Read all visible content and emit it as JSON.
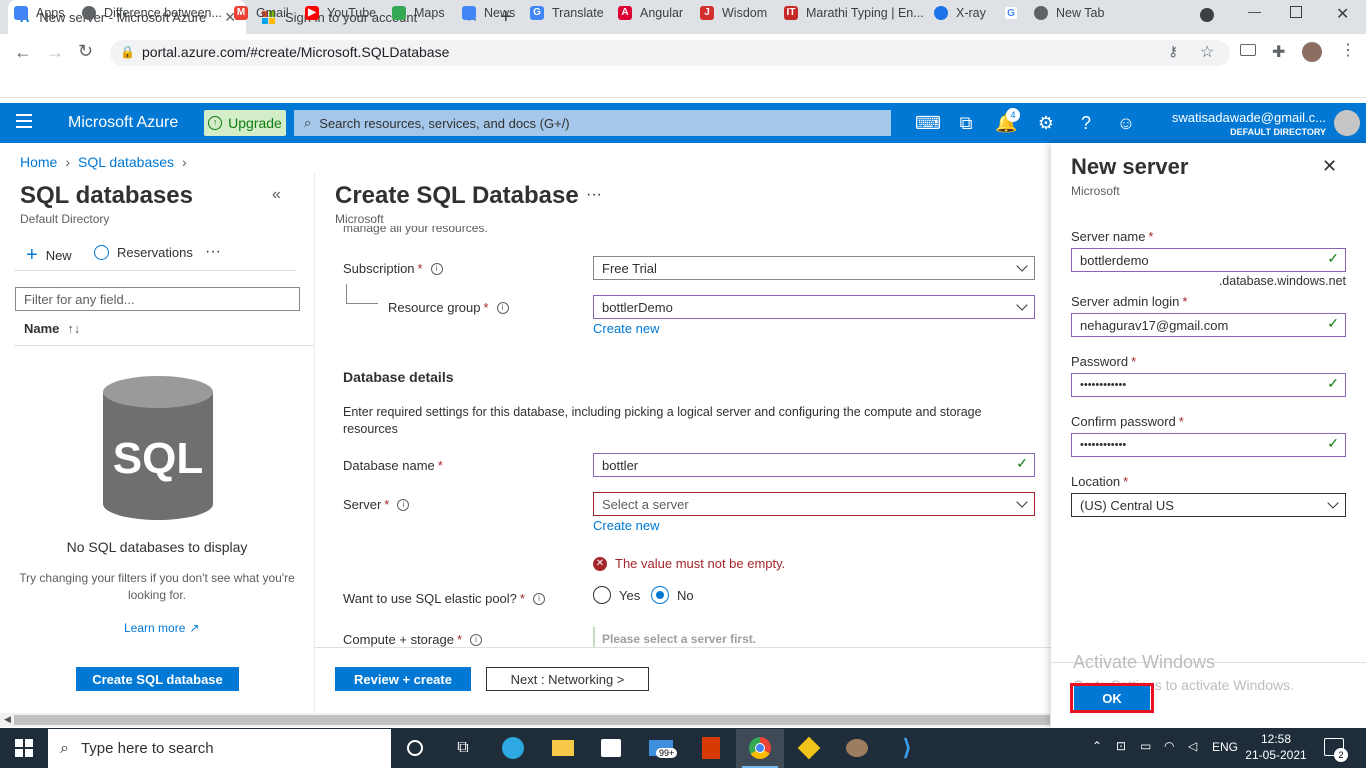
{
  "browser": {
    "tabs": [
      {
        "title": "New server - Microsoft Azure"
      },
      {
        "title": "Sign in to your account"
      }
    ],
    "url": "portal.azure.com/#create/Microsoft.SQLDatabase",
    "bookmarks": [
      "Apps",
      "Difference between...",
      "Gmail",
      "YouTube",
      "Maps",
      "News",
      "Translate",
      "Angular",
      "Wisdom",
      "Marathi Typing | En...",
      "X-ray",
      "New Tab"
    ]
  },
  "azure": {
    "brand": "Microsoft Azure",
    "upgrade": "Upgrade",
    "search_placeholder": "Search resources, services, and docs (G+/)",
    "notif_count": "4",
    "user_email": "swatisadawade@gmail.c...",
    "user_dir": "DEFAULT DIRECTORY"
  },
  "breadcrumb": [
    "Home",
    "SQL databases"
  ],
  "left": {
    "title": "SQL databases",
    "subtitle": "Default Directory",
    "new": "New",
    "reservations": "Reservations",
    "filter_placeholder": "Filter for any field...",
    "col_name": "Name",
    "sql_logo": "SQL",
    "empty_title": "No SQL databases to display",
    "empty_hint": "Try changing your filters if you don't see what you're looking for.",
    "learn_more": "Learn more",
    "create_btn": "Create SQL database"
  },
  "center": {
    "title": "Create SQL Database",
    "publisher": "Microsoft",
    "cutoff_text": "manage all your resources.",
    "subscription_label": "Subscription",
    "subscription_value": "Free Trial",
    "rg_label": "Resource group",
    "rg_value": "bottlerDemo",
    "create_new": "Create new",
    "db_details_heading": "Database details",
    "db_details_desc": "Enter required settings for this database, including picking a logical server and configuring the compute and storage resources",
    "dbname_label": "Database name",
    "dbname_value": "bottler",
    "server_label": "Server",
    "server_placeholder": "Select a server",
    "server_error": "The value must not be empty.",
    "elastic_label": "Want to use SQL elastic pool?",
    "yes": "Yes",
    "no": "No",
    "compute_label": "Compute + storage",
    "compute_value": "Please select a server first.",
    "review_btn": "Review + create",
    "next_btn": "Next : Networking >"
  },
  "panel": {
    "title": "New server",
    "publisher": "Microsoft",
    "server_name_label": "Server name",
    "server_name_value": "bottlerdemo",
    "domain_suffix": ".database.windows.net",
    "admin_label": "Server admin login",
    "admin_value": "nehagurav17@gmail.com",
    "password_label": "Password",
    "password_value": "••••••••••••",
    "confirm_label": "Confirm password",
    "confirm_value": "••••••••••••",
    "location_label": "Location",
    "location_value": "(US) Central US",
    "ok_btn": "OK",
    "watermark1": "Activate Windows",
    "watermark2": "Go to Settings to activate Windows."
  },
  "taskbar": {
    "search_placeholder": "Type here to search",
    "mail_badge": "99+",
    "lang": "ENG",
    "time": "12:58",
    "date": "21-05-2021",
    "notif": "2"
  }
}
